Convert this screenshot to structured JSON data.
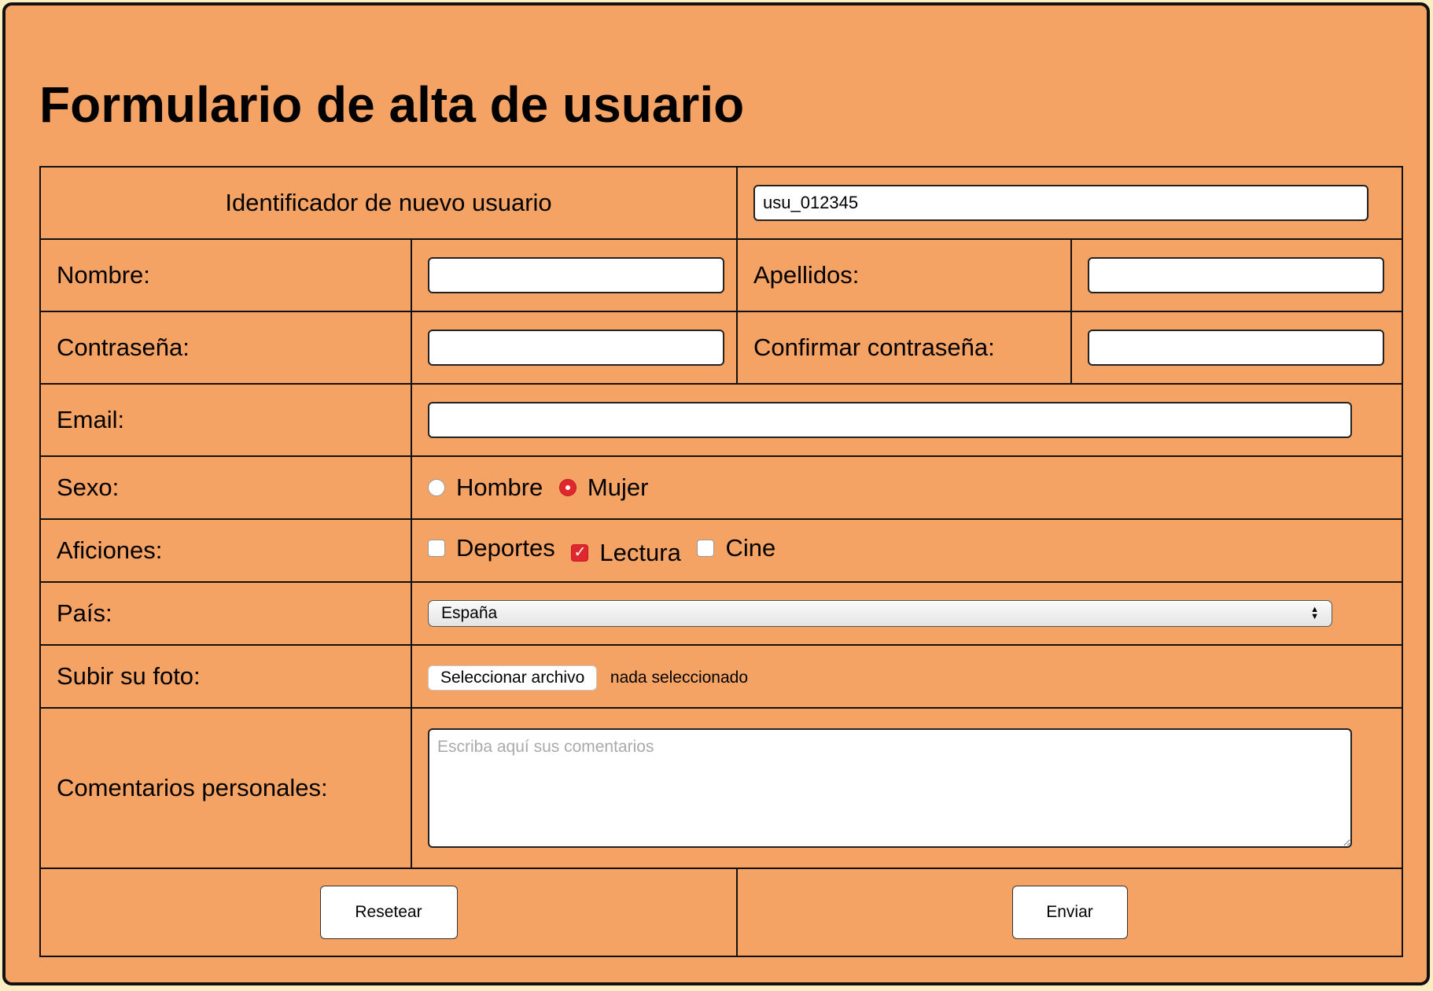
{
  "form": {
    "title": "Formulario de alta de usuario",
    "user_id": {
      "label": "Identificador de nuevo usuario",
      "value": "usu_012345"
    },
    "nombre": {
      "label": "Nombre:",
      "value": ""
    },
    "apellidos": {
      "label": "Apellidos:",
      "value": ""
    },
    "contrasena": {
      "label": "Contraseña:",
      "value": ""
    },
    "confirmar": {
      "label": "Confirmar contraseña:",
      "value": ""
    },
    "email": {
      "label": "Email:",
      "value": ""
    },
    "sexo": {
      "label": "Sexo:",
      "options": [
        "Hombre",
        "Mujer"
      ],
      "selected": "Mujer"
    },
    "aficiones": {
      "label": "Aficiones:",
      "options": [
        "Deportes",
        "Lectura",
        "Cine"
      ],
      "checked": [
        "Lectura"
      ]
    },
    "pais": {
      "label": "País:",
      "selected": "España"
    },
    "foto": {
      "label": "Subir su foto:",
      "button_label": "Seleccionar archivo",
      "status": "nada seleccionado"
    },
    "comentarios": {
      "label": "Comentarios personales:",
      "placeholder": "Escriba aquí sus comentarios",
      "value": ""
    },
    "buttons": {
      "reset_label": "Resetear",
      "submit_label": "Enviar"
    }
  },
  "colors": {
    "background": "#f5a365",
    "accent": "#e0272e",
    "border": "#111111"
  },
  "icons": {
    "select_arrow": "up-down-arrows-icon",
    "check_mark": "checkmark-icon"
  }
}
